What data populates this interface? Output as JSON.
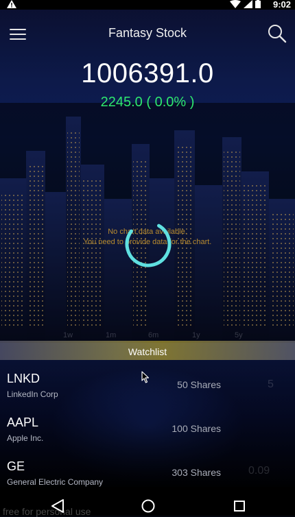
{
  "status_bar": {
    "time": "9:02",
    "alert_icon": "warning-icon",
    "icons": [
      "wifi-icon",
      "signal-icon",
      "battery-icon"
    ]
  },
  "app_bar": {
    "title": "Fantasy Stock",
    "menu_icon": "hamburger-menu-icon",
    "search_icon": "search-icon"
  },
  "portfolio": {
    "balance": "1006391.0",
    "change": "2245.0 ( 0.0% )",
    "change_color": "#2ee86e"
  },
  "chart": {
    "empty_line1": "No chart data available.",
    "empty_line2": "You need to provide data for the chart.",
    "empty_color": "#b88b2e",
    "spinner_color": "#5fe0e0",
    "axis_labels": [
      "1w",
      "1m",
      "6m",
      "1y",
      "5y"
    ]
  },
  "watchlist": {
    "heading": "Watchlist",
    "items": [
      {
        "symbol": "LNKD",
        "name": "LinkedIn Corp",
        "shares": "50 Shares"
      },
      {
        "symbol": "AAPL",
        "name": "Apple Inc.",
        "shares": "100 Shares"
      },
      {
        "symbol": "GE",
        "name": "General Electric Company",
        "shares": "303 Shares"
      }
    ]
  },
  "ghost_text": {
    "row3_value": "0.09",
    "row1_value": "5"
  },
  "nav_bar": {
    "back_icon": "back-triangle-icon",
    "home_icon": "home-circle-icon",
    "recents_icon": "recents-square-icon"
  },
  "watermark": "free for personal use"
}
